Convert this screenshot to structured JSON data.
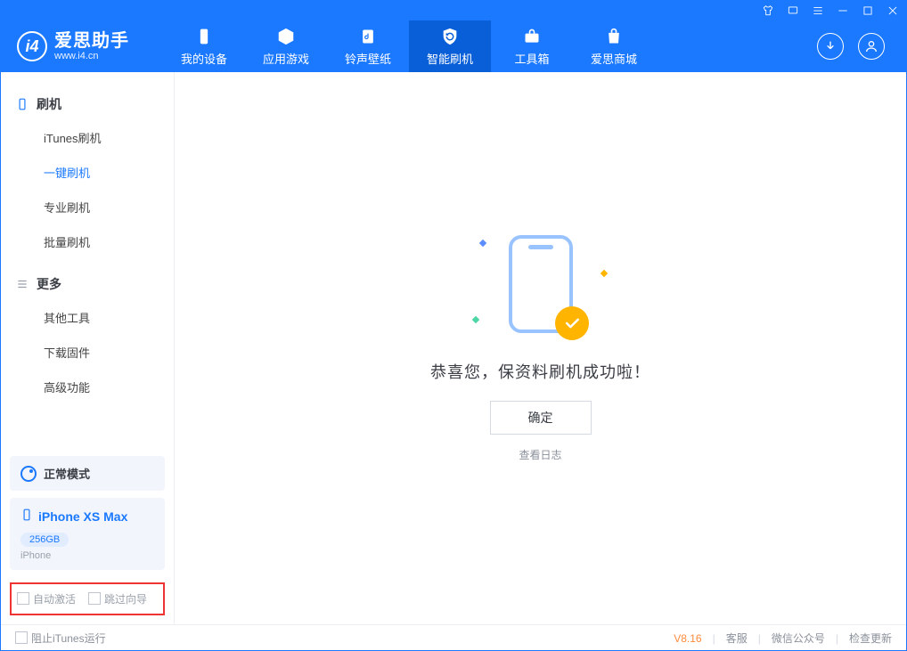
{
  "app": {
    "name": "爱思助手",
    "domain": "www.i4.cn"
  },
  "titlebar_icons": [
    "tshirt",
    "rect",
    "menu",
    "min",
    "max",
    "close"
  ],
  "nav": {
    "items": [
      {
        "id": "device",
        "label": "我的设备"
      },
      {
        "id": "apps",
        "label": "应用游戏"
      },
      {
        "id": "ringtone",
        "label": "铃声壁纸"
      },
      {
        "id": "flash",
        "label": "智能刷机"
      },
      {
        "id": "toolbox",
        "label": "工具箱"
      },
      {
        "id": "store",
        "label": "爱思商城"
      }
    ],
    "active": "flash"
  },
  "sidebar": {
    "group1_title": "刷机",
    "group1_items": [
      "iTunes刷机",
      "一键刷机",
      "专业刷机",
      "批量刷机"
    ],
    "group1_active_index": 1,
    "group2_title": "更多",
    "group2_items": [
      "其他工具",
      "下载固件",
      "高级功能"
    ],
    "mode_label": "正常模式",
    "device": {
      "name": "iPhone XS Max",
      "storage": "256GB",
      "type": "iPhone"
    },
    "checkbox1": "自动激活",
    "checkbox2": "跳过向导"
  },
  "main": {
    "success_text": "恭喜您，保资料刷机成功啦！",
    "ok_button": "确定",
    "view_log": "查看日志"
  },
  "statusbar": {
    "block_itunes": "阻止iTunes运行",
    "version": "V8.16",
    "links": [
      "客服",
      "微信公众号",
      "检查更新"
    ]
  }
}
